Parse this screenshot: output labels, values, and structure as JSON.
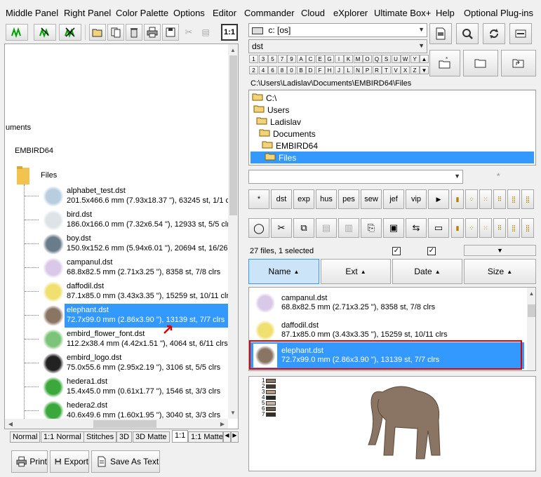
{
  "menu": [
    "Middle Panel",
    "Right Panel",
    "Color Palette",
    "Options",
    "Editor",
    "Commander",
    "Cloud",
    "eXplorer",
    "Ultimate Box+",
    "Help",
    "Optional Plug-ins"
  ],
  "toolbar": {
    "ratio_label": "1:1"
  },
  "left_tree": {
    "partial_label": "uments",
    "embird_label": "EMBIRD64",
    "files_label": "Files"
  },
  "left_files": [
    {
      "name": "alphabet_test.dst",
      "info": "201.5x466.6 mm (7.93x18.37 \"), 63245 st, 1/1 clrs"
    },
    {
      "name": "bird.dst",
      "info": "186.0x166.0 mm (7.32x6.54 \"), 12933 st, 5/5 clrs"
    },
    {
      "name": "boy.dst",
      "info": "150.9x152.6 mm (5.94x6.01 \"), 20694 st, 16/26 clrs"
    },
    {
      "name": "campanul.dst",
      "info": "68.8x82.5 mm (2.71x3.25 \"), 8358 st, 7/8 clrs"
    },
    {
      "name": "daffodil.dst",
      "info": "87.1x85.0 mm (3.43x3.35 \"), 15259 st, 10/11 clrs"
    },
    {
      "name": "elephant.dst",
      "info": "72.7x99.0 mm (2.86x3.90 \"), 13139 st, 7/7 clrs"
    },
    {
      "name": "embird_flower_font.dst",
      "info": "112.2x38.4 mm (4.42x1.51 \"), 4064 st, 6/11 clrs"
    },
    {
      "name": "embird_logo.dst",
      "info": "75.0x55.6 mm (2.95x2.19 \"), 3106 st, 5/5 clrs"
    },
    {
      "name": "hedera1.dst",
      "info": "15.4x45.0 mm (0.61x1.77 \"), 1546 st, 3/3 clrs"
    },
    {
      "name": "hedera2.dst",
      "info": "40.6x49.6 mm (1.60x1.95 \"), 3040 st, 3/3 clrs"
    }
  ],
  "view_tabs": [
    "Normal",
    "1:1 Normal",
    "Stitches",
    "3D",
    "3D Matte",
    "1:1",
    "1:1 Matte"
  ],
  "bottom_buttons": {
    "print": "Print",
    "export": "Export",
    "save_as_text": "Save As Text"
  },
  "drive_combo": "c: [os]",
  "filter_combo": "dst",
  "keys_row1": [
    "1",
    "3",
    "5",
    "7",
    "9",
    "A",
    "C",
    "E",
    "G",
    "I",
    "K",
    "M",
    "O",
    "Q",
    "S",
    "U",
    "W",
    "Y"
  ],
  "keys_row2": [
    "2",
    "4",
    "6",
    "8",
    "0",
    "B",
    "D",
    "F",
    "H",
    "J",
    "L",
    "N",
    "P",
    "R",
    "T",
    "V",
    "X",
    "Z"
  ],
  "path": "C:\\Users\\Ladislav\\Documents\\EMBIRD64\\Files",
  "folders": [
    "C:\\",
    "Users",
    "Ladislav",
    "Documents",
    "EMBIRD64",
    "Files"
  ],
  "format_buttons": [
    "*",
    "dst",
    "exp",
    "hus",
    "pes",
    "sew",
    "jef",
    "vip"
  ],
  "status": "27 files, 1 selected",
  "headers": {
    "name": "Name",
    "ext": "Ext",
    "date": "Date",
    "size": "Size"
  },
  "right_files": [
    {
      "name": "campanul.dst",
      "info": "68.8x82.5 mm (2.71x3.25 \"), 8358 st, 7/8 clrs"
    },
    {
      "name": "daffodil.dst",
      "info": "87.1x85.0 mm (3.43x3.35 \"), 15259 st, 10/11 clrs"
    },
    {
      "name": "elephant.dst",
      "info": "72.7x99.0 mm (2.86x3.90 \"), 13139 st, 7/7 clrs"
    }
  ],
  "color_list": [
    "1",
    "2",
    "3",
    "4",
    "5",
    "6",
    "7"
  ],
  "colors": {
    "selection": "#3399ff",
    "highlight_border": "#e00000"
  }
}
